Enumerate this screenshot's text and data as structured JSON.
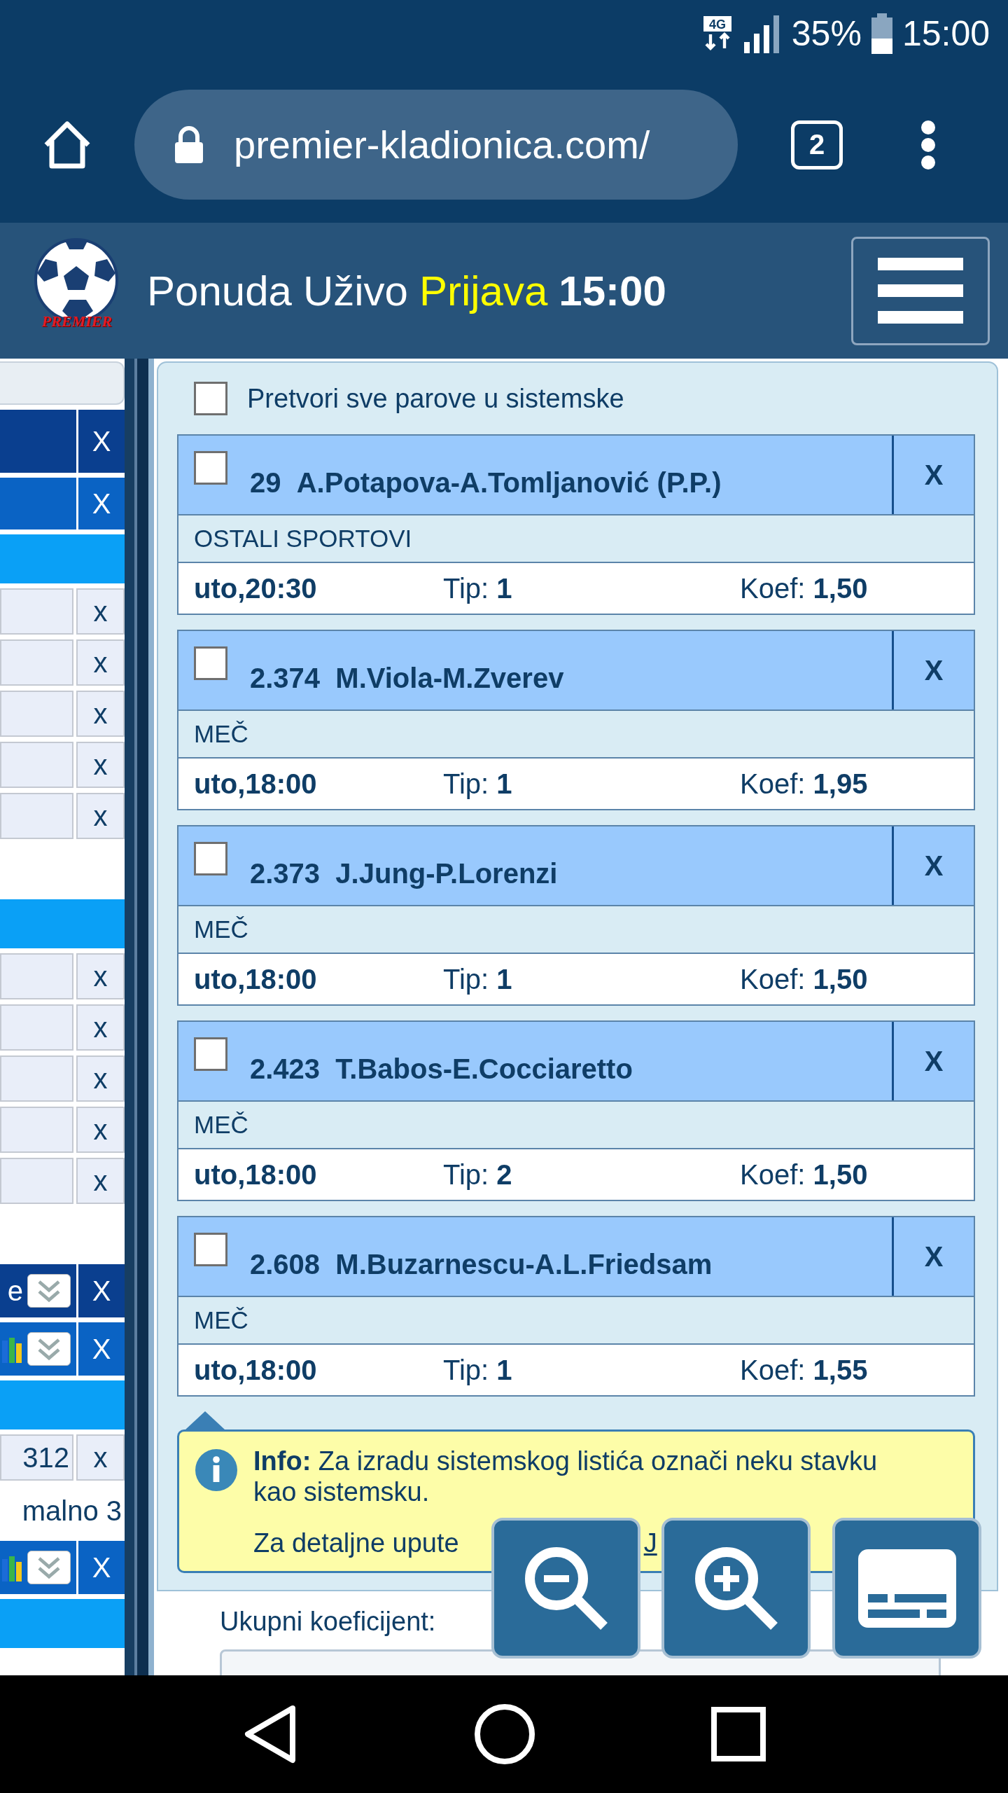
{
  "status_bar": {
    "network": "4G",
    "battery": "35%",
    "time": "15:00"
  },
  "browser": {
    "url": "premier-kladionica.com/",
    "tab_count": "2"
  },
  "header": {
    "logo_text": "PREMIER",
    "links": [
      {
        "label": "Ponuda",
        "highlighted": false
      },
      {
        "label": "Uživo",
        "highlighted": false
      },
      {
        "label": "Prijava",
        "highlighted": true
      }
    ],
    "time": "15:00"
  },
  "left_column": [
    {
      "kind": "field"
    },
    {
      "kind": "dark",
      "close": "X"
    },
    {
      "kind": "mid",
      "close": "X"
    },
    {
      "kind": "bright"
    },
    {
      "kind": "light",
      "close": "x"
    },
    {
      "kind": "light",
      "close": "x"
    },
    {
      "kind": "light",
      "close": "x"
    },
    {
      "kind": "light",
      "close": "x"
    },
    {
      "kind": "light",
      "close": "x"
    },
    {
      "kind": "blank"
    },
    {
      "kind": "bright"
    },
    {
      "kind": "light",
      "close": "x"
    },
    {
      "kind": "light",
      "close": "x"
    },
    {
      "kind": "light",
      "close": "x"
    },
    {
      "kind": "light",
      "close": "x"
    },
    {
      "kind": "light",
      "close": "x"
    },
    {
      "kind": "blank"
    },
    {
      "kind": "select",
      "text": "e",
      "close": "X"
    },
    {
      "kind": "stats",
      "close": "X"
    },
    {
      "kind": "bright"
    },
    {
      "kind": "light",
      "text": "312",
      "close": "x"
    },
    {
      "kind": "blank",
      "text": "malno 3"
    },
    {
      "kind": "stats",
      "close": "X"
    },
    {
      "kind": "bright"
    }
  ],
  "ticket": {
    "convert_all": {
      "label": "Pretvori sve parove u sistemske",
      "checked": false
    },
    "bets": [
      {
        "number": "29",
        "match": "A.Potapova-A.Tomljanović (P.P.)",
        "close": "X",
        "checked": false,
        "category": "OSTALI SPORTOVI",
        "time": "uto,20:30",
        "tip_label": "Tip:",
        "tip": "1",
        "odds_label": "Koef:",
        "odds": "1,50"
      },
      {
        "number": "2.374",
        "match": "M.Viola-M.Zverev",
        "close": "X",
        "checked": false,
        "category": "MEČ",
        "time": "uto,18:00",
        "tip_label": "Tip:",
        "tip": "1",
        "odds_label": "Koef:",
        "odds": "1,95"
      },
      {
        "number": "2.373",
        "match": "J.Jung-P.Lorenzi",
        "close": "X",
        "checked": false,
        "category": "MEČ",
        "time": "uto,18:00",
        "tip_label": "Tip:",
        "tip": "1",
        "odds_label": "Koef:",
        "odds": "1,50"
      },
      {
        "number": "2.423",
        "match": "T.Babos-E.Cocciaretto",
        "close": "X",
        "checked": false,
        "category": "MEČ",
        "time": "uto,18:00",
        "tip_label": "Tip:",
        "tip": "2",
        "odds_label": "Koef:",
        "odds": "1,50"
      },
      {
        "number": "2.608",
        "match": "M.Buzarnescu-A.L.Friedsam",
        "close": "X",
        "checked": false,
        "category": "MEČ",
        "time": "uto,18:00",
        "tip_label": "Tip:",
        "tip": "1",
        "odds_label": "Koef:",
        "odds": "1,55"
      }
    ],
    "info": {
      "text": "**Info:** Za izradu sistemskog listića označi neku stavku kao sistemsku.",
      "details": "Za detaljne upute",
      "link": "J"
    },
    "total_label": "Ukupni koeficijent:"
  }
}
